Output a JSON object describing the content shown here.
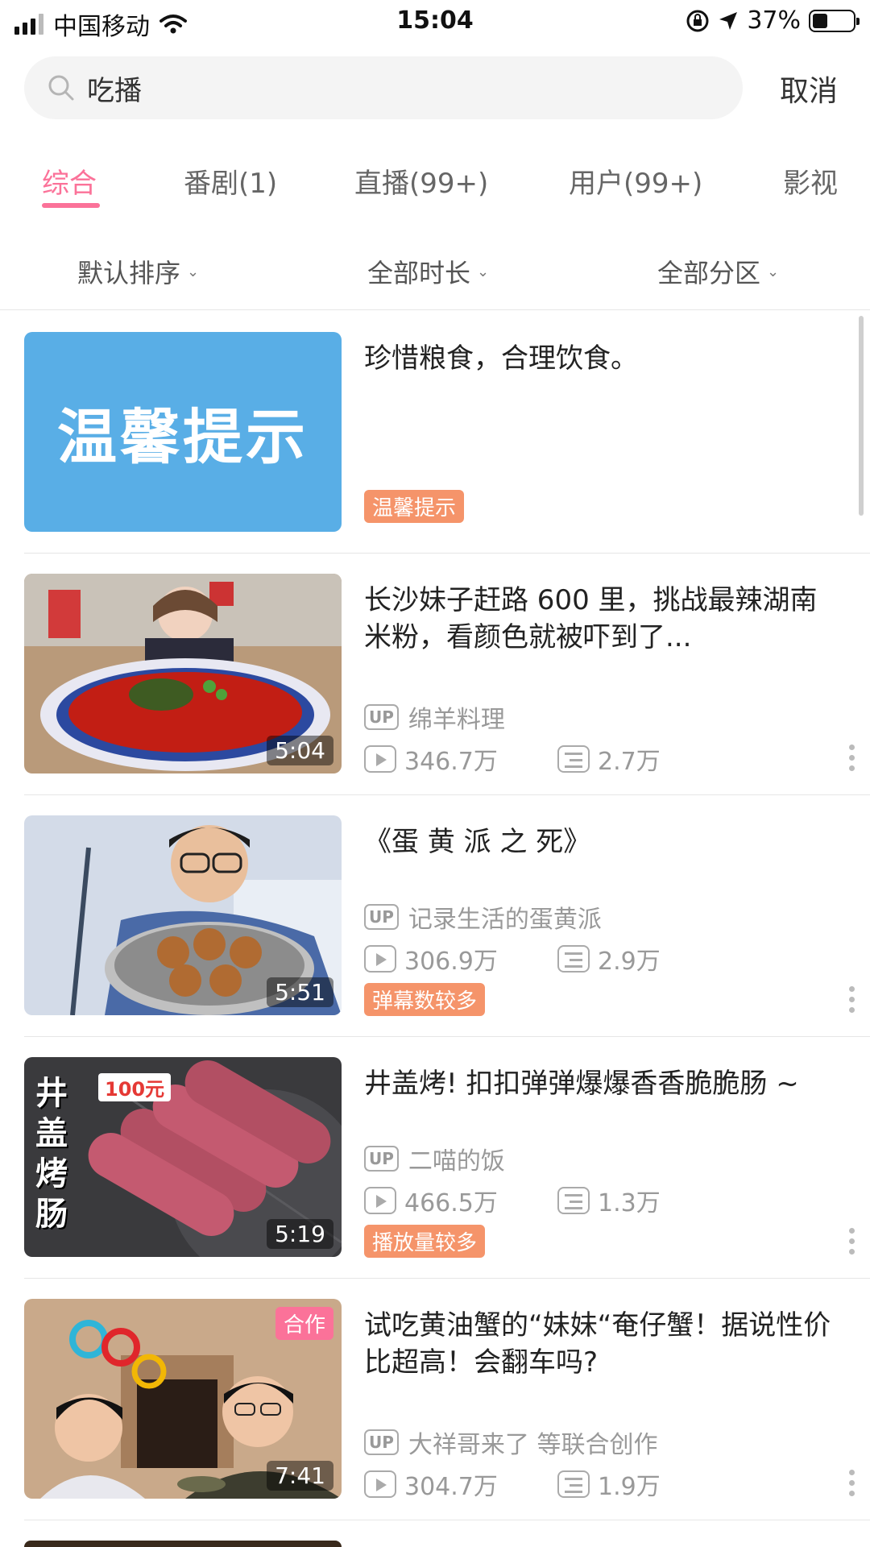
{
  "status_bar": {
    "carrier": "中国移动",
    "time": "15:04",
    "battery": "37%"
  },
  "search": {
    "query": "吃播",
    "cancel_label": "取消"
  },
  "tabs": [
    {
      "label": "综合",
      "active": true
    },
    {
      "label": "番剧(1)",
      "active": false
    },
    {
      "label": "直播(99+)",
      "active": false
    },
    {
      "label": "用户(99+)",
      "active": false
    },
    {
      "label": "影视",
      "active": false
    }
  ],
  "filters": [
    {
      "label": "默认排序"
    },
    {
      "label": "全部时长"
    },
    {
      "label": "全部分区"
    }
  ],
  "results": [
    {
      "thumb_text": "温馨提示",
      "title": "珍惜粮食，合理饮食。",
      "badge": "温馨提示"
    },
    {
      "title": "长沙妹子赶路 600 里，挑战最辣湖南米粉，看颜色就被吓到了...",
      "duration": "5:04",
      "up_label": "UP",
      "uploader": "绵羊料理",
      "views": "346.7万",
      "danmaku": "2.7万"
    },
    {
      "title": "《蛋 黄 派 之 死》",
      "duration": "5:51",
      "up_label": "UP",
      "uploader": "记录生活的蛋黄派",
      "views": "306.9万",
      "danmaku": "2.9万",
      "badge": "弹幕数较多"
    },
    {
      "title": "井盖烤! 扣扣弹弹爆爆香香脆脆肠 ~",
      "duration": "5:19",
      "thumb_text_vertical": "井盖烤肠",
      "thumb_price": "100元",
      "up_label": "UP",
      "uploader": "二喵的饭",
      "views": "466.5万",
      "danmaku": "1.3万",
      "badge": "播放量较多"
    },
    {
      "title": "试吃黄油蟹的“妹妹“奄仔蟹！据说性价比超高！会翻车吗?",
      "duration": "7:41",
      "coop": "合作",
      "up_label": "UP",
      "uploader": "大祥哥来了 等联合创作",
      "views": "304.7万",
      "danmaku": "1.9万"
    }
  ],
  "colors": {
    "accent": "#fb7299",
    "badge_orange": "#f5946a",
    "tip_blue": "#59aee6"
  }
}
